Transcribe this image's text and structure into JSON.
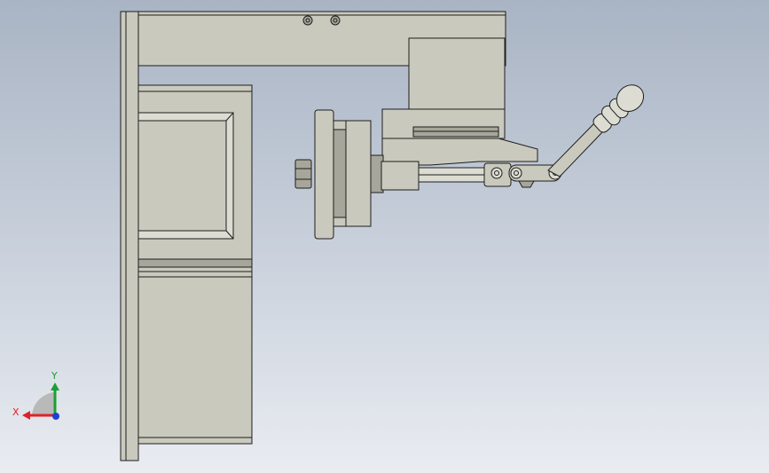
{
  "viewport": {
    "background_top": "#a9b4c4",
    "background_bottom": "#e9ecf1"
  },
  "triad": {
    "x_label": "X",
    "y_label": "Y",
    "x_color": "#e0202a",
    "y_color": "#1aa033",
    "z_color": "#1c3fd8"
  },
  "model": {
    "body_color": "#c9c9bd",
    "edge_color": "#1e1e1e"
  }
}
